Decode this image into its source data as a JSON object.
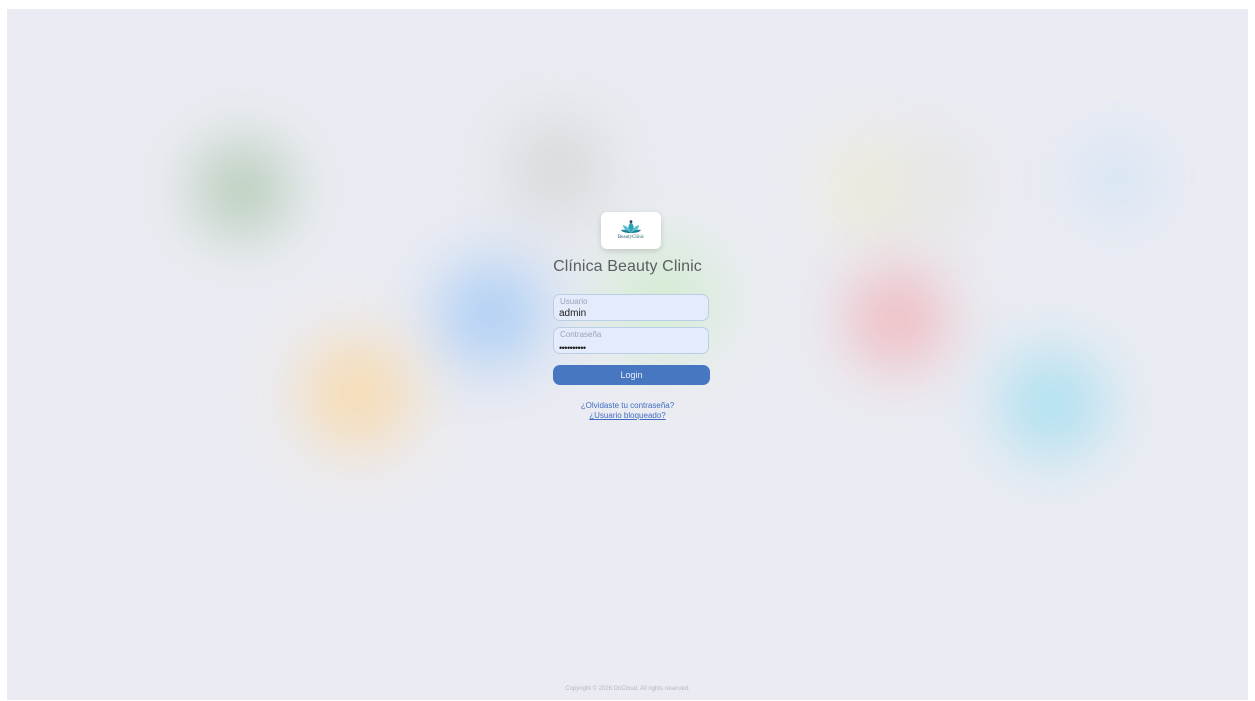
{
  "app": {
    "title": "Clínica Beauty Clinic",
    "logo_text": "BeautyClinic"
  },
  "login": {
    "username_label": "Usuario",
    "username_value": "admin",
    "password_label": "Contraseña",
    "password_value": "••••••••••",
    "submit_label": "Login",
    "forgot_password_link": "¿Olvidaste tu contraseña?",
    "blocked_user_link": "¿Usuario bloqueado?"
  },
  "footer": {
    "copyright": "Copyright © 2026 DriCloud. All rights reserved."
  },
  "colors": {
    "background": "#ebecf3",
    "accent": "#4677c0",
    "link": "#3f6cc0",
    "field_bg": "#e4ecfb"
  },
  "icons": {
    "logo": "lotus-icon"
  }
}
